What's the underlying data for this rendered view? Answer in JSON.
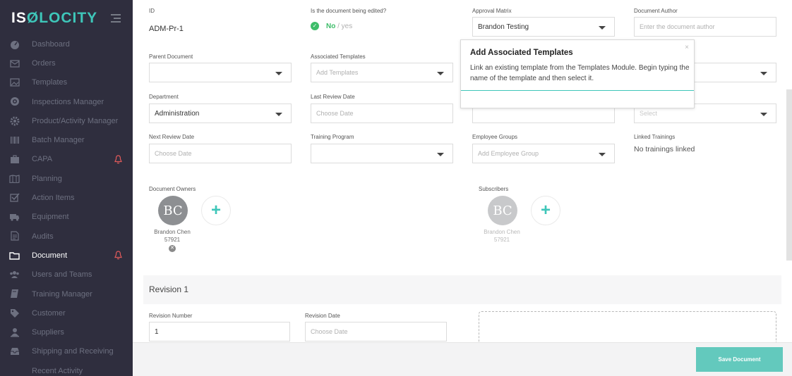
{
  "brand": {
    "logo_left": "IS",
    "logo_o": "Ø",
    "logo_right": "LOCITY",
    "accent": "#3ec6b9"
  },
  "sidebar": {
    "items": [
      {
        "label": "Dashboard",
        "icon": "dashboard-icon",
        "active": false,
        "bell": false
      },
      {
        "label": "Orders",
        "icon": "envelope-icon",
        "active": false,
        "bell": false
      },
      {
        "label": "Templates",
        "icon": "image-icon",
        "active": false,
        "bell": false
      },
      {
        "label": "Inspections Manager",
        "icon": "target-icon",
        "active": false,
        "bell": false
      },
      {
        "label": "Product/Activity Manager",
        "icon": "gear-icon",
        "active": false,
        "bell": false
      },
      {
        "label": "Batch Manager",
        "icon": "barcode-icon",
        "active": false,
        "bell": false
      },
      {
        "label": "CAPA",
        "icon": "briefcase-icon",
        "active": false,
        "bell": true
      },
      {
        "label": "Planning",
        "icon": "map-icon",
        "active": false,
        "bell": false
      },
      {
        "label": "Action Items",
        "icon": "checkbox-icon",
        "active": false,
        "bell": false
      },
      {
        "label": "Equipment",
        "icon": "truck-icon",
        "active": false,
        "bell": false
      },
      {
        "label": "Audits",
        "icon": "file-icon",
        "active": false,
        "bell": false
      },
      {
        "label": "Document",
        "icon": "folder-icon",
        "active": true,
        "bell": true
      },
      {
        "label": "Users and Teams",
        "icon": "users-icon",
        "active": false,
        "bell": false
      },
      {
        "label": "Training Manager",
        "icon": "book-icon",
        "active": false,
        "bell": false
      },
      {
        "label": "Customer",
        "icon": "tag-icon",
        "active": false,
        "bell": false
      },
      {
        "label": "Suppliers",
        "icon": "supplier-icon",
        "active": false,
        "bell": false
      },
      {
        "label": "Shipping and Receiving",
        "icon": "inbox-icon",
        "active": false,
        "bell": false
      },
      {
        "label": "Recent Activity",
        "icon": "",
        "active": false,
        "bell": false
      }
    ]
  },
  "form": {
    "id_label": "ID",
    "id_value": "ADM-Pr-1",
    "edited_label": "Is the document being edited?",
    "edited_no": "No",
    "edited_rest": " / yes",
    "approval_label": "Approval Matrix",
    "approval_value": "Brandon Testing",
    "author_label": "Document Author",
    "author_placeholder": "Enter the document author",
    "parent_label": "Parent Document",
    "assoc_label": "Associated Templates",
    "assoc_placeholder": "Add Templates",
    "dept_label": "Department",
    "dept_value": "Administration",
    "last_review_label": "Last Review Date",
    "last_review_placeholder": "Choose Date",
    "select_placeholder": "Select",
    "next_review_label": "Next Review Date",
    "next_review_placeholder": "Choose Date",
    "training_label": "Training Program",
    "emp_groups_label": "Employee Groups",
    "emp_groups_placeholder": "Add Employee Group",
    "linked_label": "Linked Trainings",
    "linked_value": "No trainings linked",
    "owners_label": "Document Owners",
    "subscribers_label": "Subscribers",
    "owner_initials": "BC",
    "owner_name": "Brandon Chen",
    "owner_id": "57921",
    "subscriber_initials": "BC",
    "subscriber_name": "Brandon Chen",
    "subscriber_id": "57921"
  },
  "revision": {
    "title": "Revision 1",
    "number_label": "Revision Number",
    "number_value": "1",
    "date_label": "Revision Date",
    "date_placeholder": "Choose Date"
  },
  "popup": {
    "title": "Add Associated Templates",
    "body": "Link an existing template from the Templates Module. Begin typing the name of the template and then select it.",
    "close": "×"
  },
  "footer": {
    "save_label": "Save Document"
  }
}
